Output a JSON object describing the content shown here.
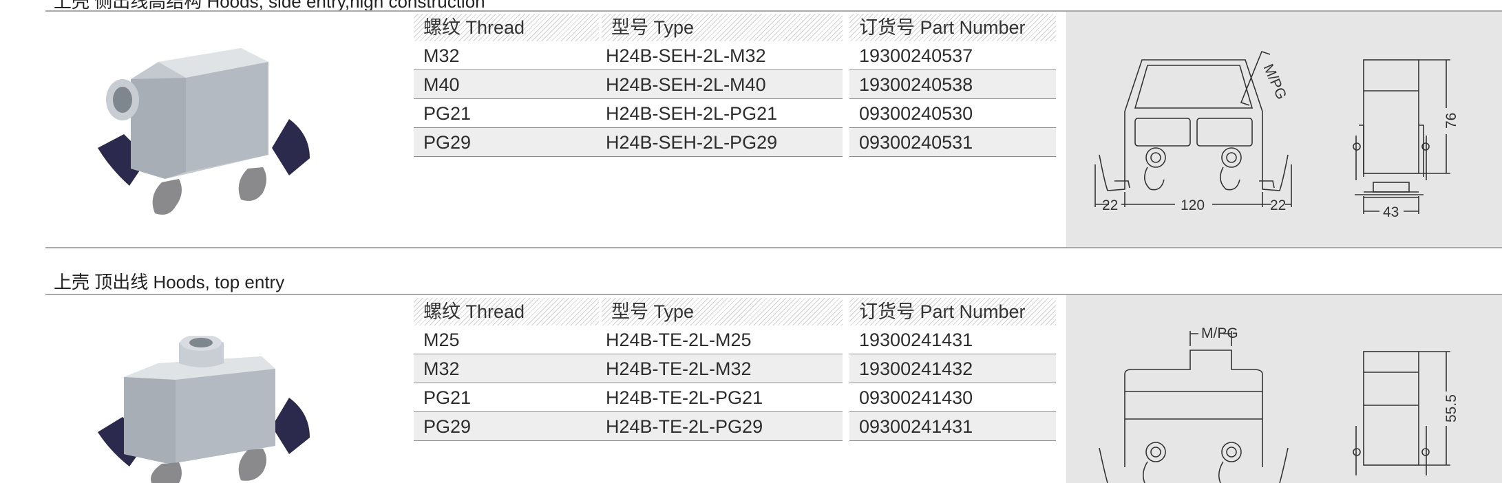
{
  "section1": {
    "title": "上壳 侧出线高结构 Hoods, side entry,high construction",
    "headers": [
      "螺纹 Thread",
      "型号 Type",
      "订货号 Part Number"
    ],
    "rows": [
      [
        "M32",
        "H24B-SEH-2L-M32",
        "19300240537"
      ],
      [
        "M40",
        "H24B-SEH-2L-M40",
        "19300240538"
      ],
      [
        "PG21",
        "H24B-SEH-2L-PG21",
        "09300240530"
      ],
      [
        "PG29",
        "H24B-SEH-2L-PG29",
        "09300240531"
      ]
    ],
    "dims": {
      "entry": "M/PG",
      "height": "76",
      "left": "22",
      "width": "120",
      "right": "22",
      "depth": "43"
    }
  },
  "section2": {
    "title": "上壳 顶出线  Hoods, top entry",
    "headers": [
      "螺纹 Thread",
      "型号 Type",
      "订货号 Part Number"
    ],
    "rows": [
      [
        "M25",
        "H24B-TE-2L-M25",
        "19300241431"
      ],
      [
        "M32",
        "H24B-TE-2L-M32",
        "19300241432"
      ],
      [
        "PG21",
        "H24B-TE-2L-PG21",
        "09300241430"
      ],
      [
        "PG29",
        "H24B-TE-2L-PG29",
        "09300241431"
      ]
    ],
    "dims": {
      "entry": "M/PG",
      "height": "55.5"
    }
  },
  "colors": {
    "rule": "#a9a9a9",
    "panel": "#e6e6e6",
    "row_alt": "#eeeeee",
    "hood_body": "#b9c0c6",
    "latch": "#2c2a4c"
  }
}
